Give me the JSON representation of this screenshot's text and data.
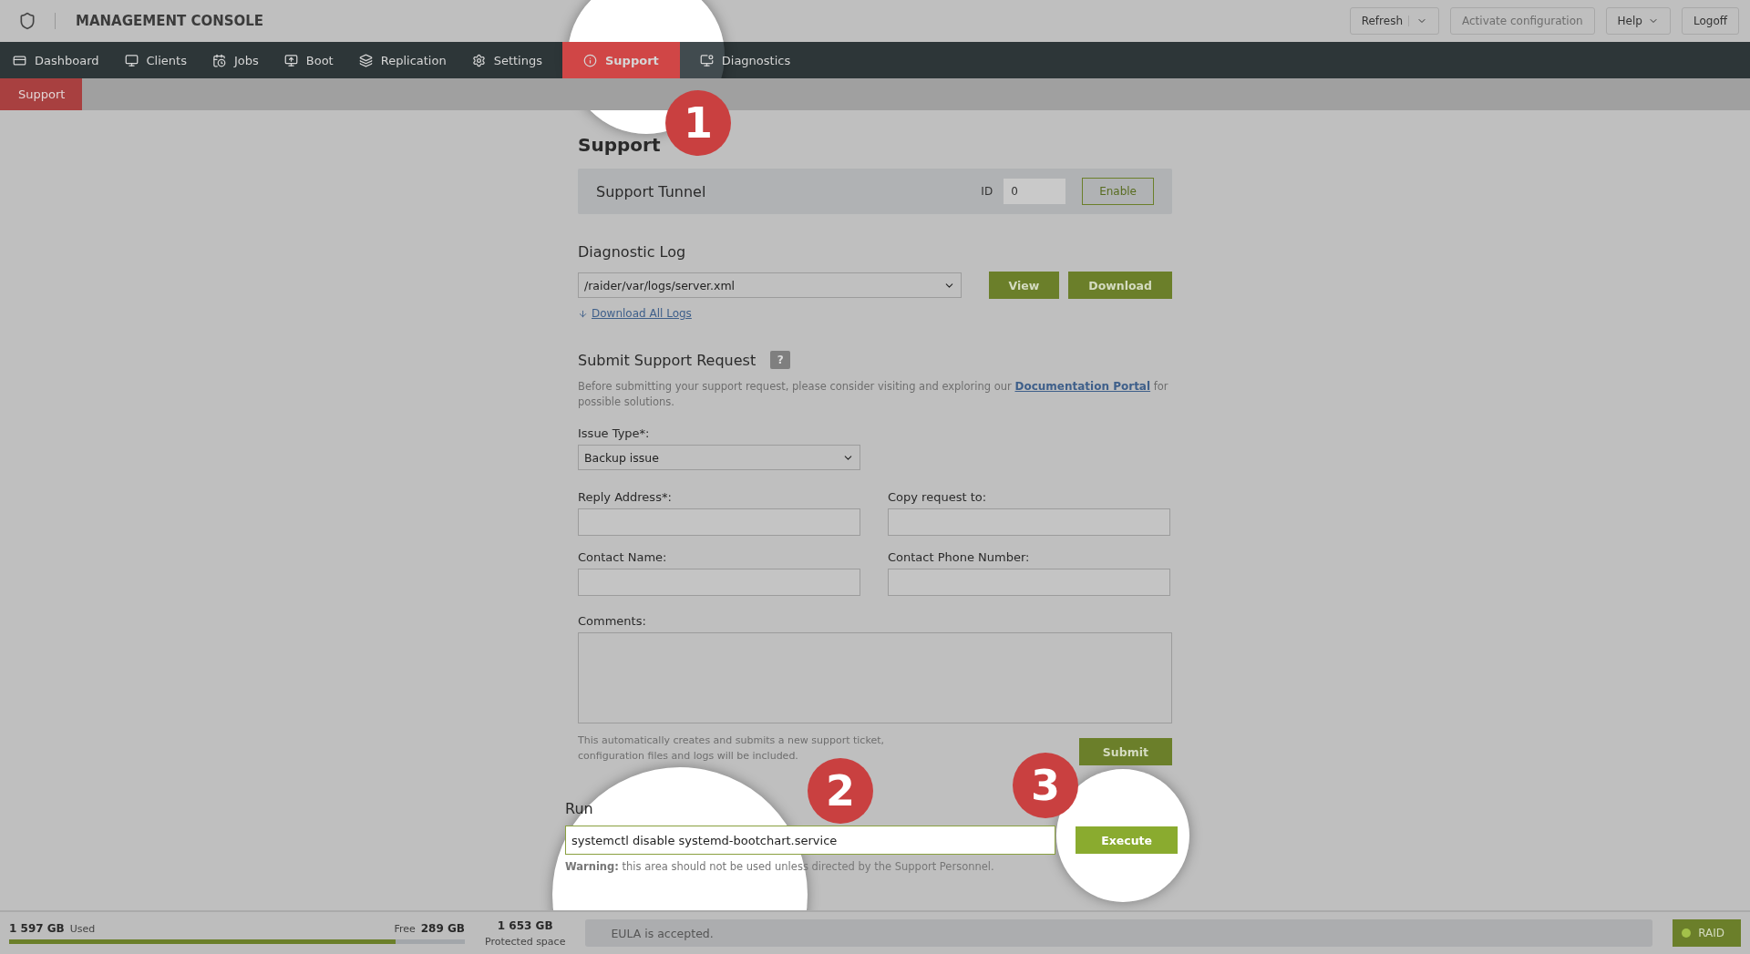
{
  "header": {
    "title": "MANAGEMENT CONSOLE",
    "buttons": [
      {
        "label": "Refresh",
        "kind": "split",
        "disabled": false
      },
      {
        "label": "Activate configuration",
        "kind": "plain",
        "disabled": true
      },
      {
        "label": "Help",
        "kind": "dropdown",
        "disabled": false
      },
      {
        "label": "Logoff",
        "kind": "plain",
        "disabled": false
      }
    ]
  },
  "nav": [
    {
      "label": "Dashboard",
      "selected": false
    },
    {
      "label": "Clients",
      "selected": false
    },
    {
      "label": "Jobs",
      "selected": false
    },
    {
      "label": "Boot",
      "selected": false
    },
    {
      "label": "Replication",
      "selected": false
    },
    {
      "label": "Settings",
      "selected": false
    },
    {
      "label": "Support",
      "selected": true
    },
    {
      "label": "Diagnostics",
      "selected": false
    }
  ],
  "subnav": [
    {
      "label": "Support",
      "selected": true
    }
  ],
  "page_title": "Support",
  "tunnel": {
    "title": "Support Tunnel",
    "id_label": "ID",
    "id_value": "0",
    "button": "Enable"
  },
  "diagnostic_log": {
    "title": "Diagnostic Log",
    "file": "/raider/var/logs/server.xml",
    "buttons": [
      "View",
      "Download"
    ],
    "link": "Download All Logs"
  },
  "request": {
    "title": "Submit Support Request",
    "help": "?",
    "intro": "Before submitting your support request, please consider visiting and exploring our",
    "intro_link": "Documentation Portal",
    "intro_end": "for possible solutions.",
    "issue_label": "Issue Type*:",
    "issue_value": "Backup issue",
    "fields": [
      {
        "label": "Reply Address*:"
      },
      {
        "label": "Copy request to:"
      },
      {
        "label": "Contact Name:"
      },
      {
        "label": "Contact Phone Number:"
      }
    ],
    "comments_label": "Comments:",
    "note": "This automatically creates and submits a new support ticket, configuration files and logs will be included.",
    "submit": "Submit"
  },
  "run": {
    "title": "Run",
    "value": "systemctl disable systemd-bootchart.service",
    "button": "Execute",
    "warning_bold": "Warning:",
    "warning": "this area should not be used unless directed by the Support Personnel."
  },
  "callouts": [
    "1",
    "2",
    "3"
  ],
  "status_bar": {
    "used": "1 597 GB",
    "used_label": "Used",
    "free_label": "Free",
    "free": "289 GB",
    "level": 0.847,
    "protected": "1 653 GB",
    "protected_label": "Protected space",
    "eula": "EULA is accepted.",
    "raid": "RAID"
  }
}
